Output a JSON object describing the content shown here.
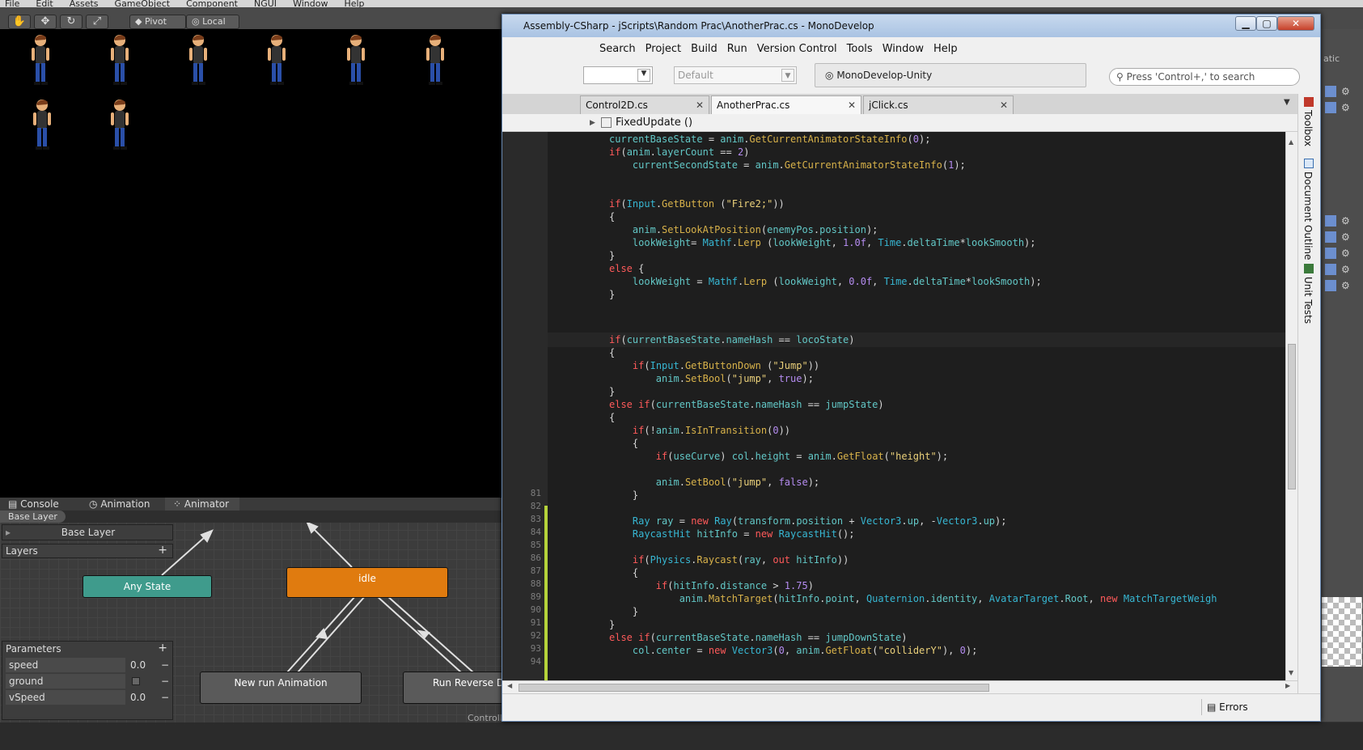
{
  "unity": {
    "menu": [
      "File",
      "Edit",
      "Assets",
      "GameObject",
      "Component",
      "NGUI",
      "Window",
      "Help"
    ],
    "pivot_label": "Pivot",
    "local_label": "Local",
    "panel_tabs": {
      "console": "Console",
      "animation": "Animation",
      "animator": "Animator"
    },
    "breadcrumb": "Base Layer",
    "layer_name": "Base Layer",
    "layers_label": "Layers",
    "parameters_label": "Parameters",
    "parameters": [
      {
        "name": "speed",
        "value": "0.0"
      },
      {
        "name": "ground",
        "value": ""
      },
      {
        "name": "vSpeed",
        "value": "0.0"
      }
    ],
    "nodes": {
      "any_state": "Any State",
      "idle": "idle",
      "new_run": "New run Animation",
      "run_reverse": "Run Reverse D"
    },
    "footer_label": "Controll",
    "right_panel_label": "atic",
    "colors": {
      "idle": "#e07b0f",
      "any_state": "#3f9b8c",
      "default_node": "#5a5a5a"
    }
  },
  "monodevelop": {
    "title": "Assembly-CSharp - jScripts\\Random Prac\\AnotherPrac.cs - MonoDevelop",
    "menu": [
      "Search",
      "Project",
      "Build",
      "Run",
      "Version Control",
      "Tools",
      "Window",
      "Help"
    ],
    "config_label": "Default",
    "runtime_label": "MonoDevelop-Unity",
    "search_placeholder": "Press 'Control+,' to search",
    "tabs": [
      {
        "label": "Control2D.cs"
      },
      {
        "label": "AnotherPrac.cs"
      },
      {
        "label": "jClick.cs"
      }
    ],
    "path_method": "FixedUpdate ()",
    "side_panels": [
      "Toolbox",
      "Document Outline",
      "Unit Tests"
    ],
    "status_errors": "Errors",
    "line_numbers": [
      "81",
      "82",
      "83",
      "84",
      "85",
      "86",
      "87",
      "88",
      "89",
      "90",
      "91",
      "92",
      "93",
      "94"
    ]
  }
}
